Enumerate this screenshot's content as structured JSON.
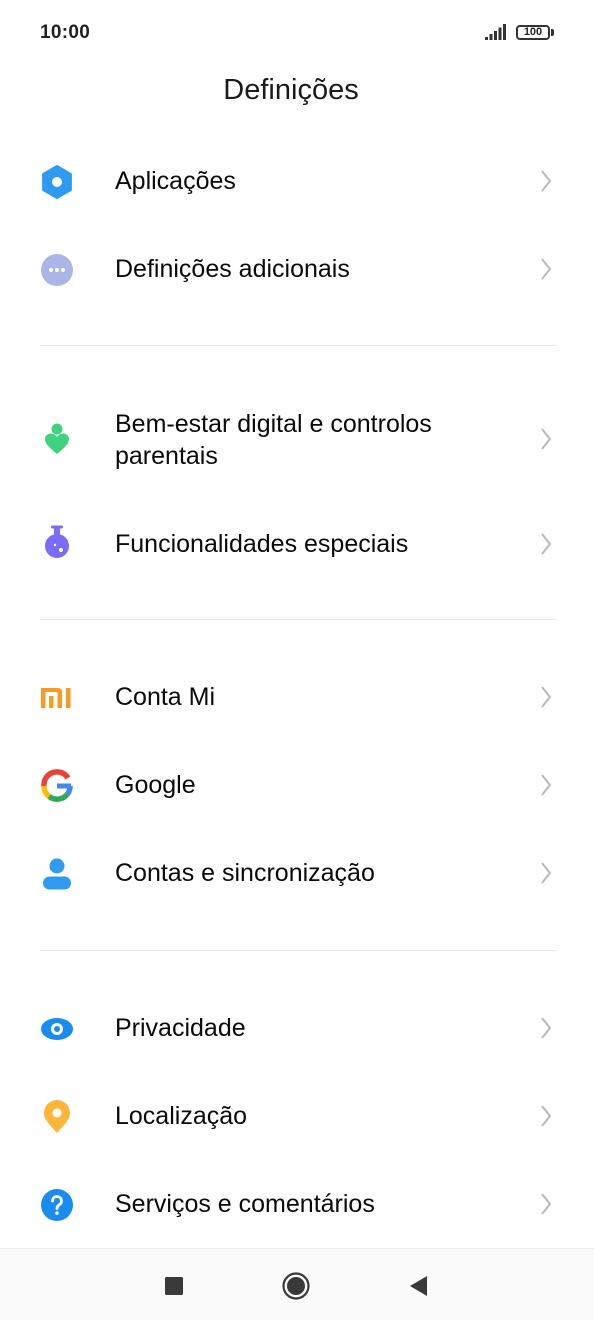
{
  "status_bar": {
    "time": "10:00",
    "battery_level": "100"
  },
  "header": {
    "title": "Definições"
  },
  "groups": [
    {
      "items": [
        {
          "label": "Aplicações",
          "icon": "gear-icon",
          "icon_color": "#2f9bf0"
        },
        {
          "label": "Definições adicionais",
          "icon": "more-dots-icon",
          "icon_color": "#a9b6e6"
        }
      ]
    },
    {
      "items": [
        {
          "label": "Bem-estar digital e controlos parentais",
          "icon": "wellbeing-icon",
          "icon_color": "#3fd27f"
        },
        {
          "label": "Funcionalidades especiais",
          "icon": "flask-icon",
          "icon_color": "#7b6cf6"
        }
      ]
    },
    {
      "items": [
        {
          "label": "Conta Mi",
          "icon": "mi-logo-icon",
          "icon_color": "#f79a26"
        },
        {
          "label": "Google",
          "icon": "google-logo-icon",
          "icon_color": "#4285f4"
        },
        {
          "label": "Contas e sincronização",
          "icon": "account-icon",
          "icon_color": "#2f9bf0"
        }
      ]
    },
    {
      "items": [
        {
          "label": "Privacidade",
          "icon": "eye-icon",
          "icon_color": "#1a8cf0"
        },
        {
          "label": "Localização",
          "icon": "location-pin-icon",
          "icon_color": "#ffb53a"
        },
        {
          "label": "Serviços e comentários",
          "icon": "help-icon",
          "icon_color": "#1a8cf0"
        }
      ]
    }
  ],
  "nav_bar": {
    "buttons": [
      "recents-button",
      "home-button",
      "back-button"
    ]
  }
}
